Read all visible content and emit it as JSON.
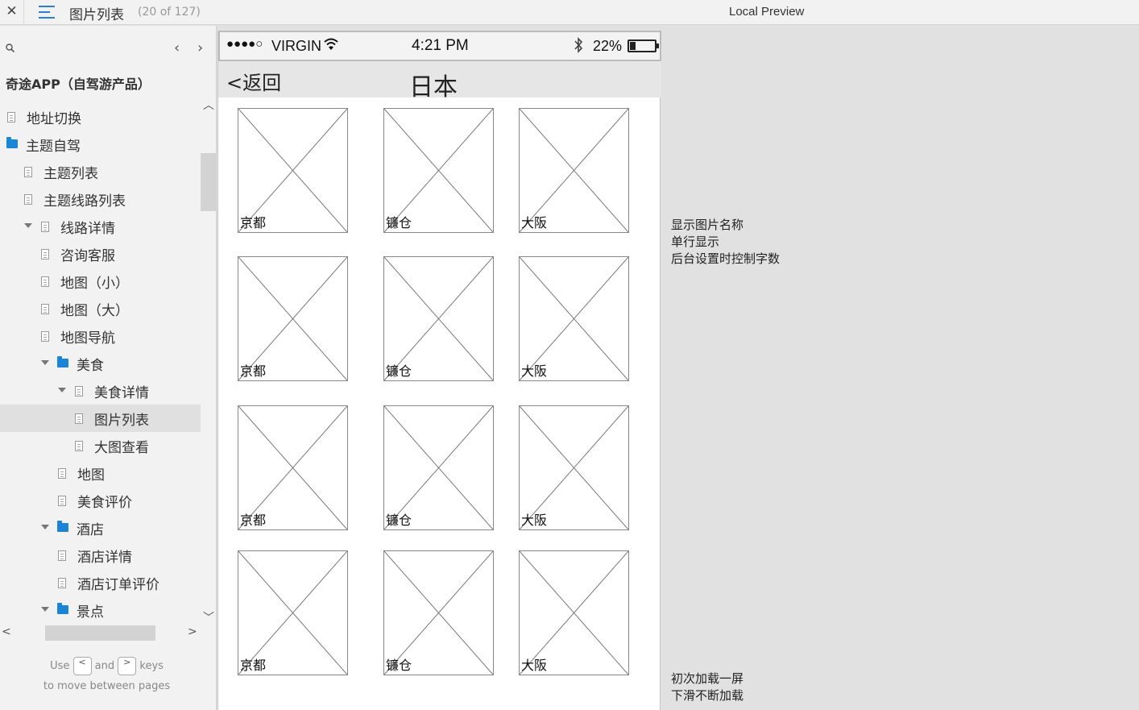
{
  "topbar": {
    "close_glyph": "✕",
    "page_title": "图片列表",
    "page_count": "(20 of 127)",
    "preview_title": "Local Preview"
  },
  "sidebar": {
    "search_icon": "search-icon",
    "prev_glyph": "‹",
    "next_glyph": "›",
    "project_title": "奇途APP（自驾游产品）",
    "items": [
      {
        "label": "地址切换",
        "type": "page",
        "level": 0,
        "expanded": false
      },
      {
        "label": "主题自驾",
        "type": "folder",
        "level": 0,
        "expanded": false
      },
      {
        "label": "主题列表",
        "type": "page",
        "level": 1,
        "expanded": false
      },
      {
        "label": "主题线路列表",
        "type": "page",
        "level": 1,
        "expanded": false
      },
      {
        "label": "线路详情",
        "type": "page",
        "level": 1,
        "expanded": true
      },
      {
        "label": "咨询客服",
        "type": "page",
        "level": 2,
        "expanded": false
      },
      {
        "label": "地图（小）",
        "type": "page",
        "level": 2,
        "expanded": false
      },
      {
        "label": "地图（大）",
        "type": "page",
        "level": 2,
        "expanded": false
      },
      {
        "label": "地图导航",
        "type": "page",
        "level": 2,
        "expanded": false
      },
      {
        "label": "美食",
        "type": "folder",
        "level": 2,
        "expanded": true
      },
      {
        "label": "美食详情",
        "type": "page",
        "level": 3,
        "expanded": true
      },
      {
        "label": "图片列表",
        "type": "page",
        "level": 4,
        "expanded": false,
        "selected": true
      },
      {
        "label": "大图查看",
        "type": "page",
        "level": 4,
        "expanded": false
      },
      {
        "label": "地图",
        "type": "page",
        "level": 3,
        "expanded": false
      },
      {
        "label": "美食评价",
        "type": "page",
        "level": 3,
        "expanded": false
      },
      {
        "label": "酒店",
        "type": "folder",
        "level": 2,
        "expanded": true
      },
      {
        "label": "酒店详情",
        "type": "page",
        "level": 3,
        "expanded": false
      },
      {
        "label": "酒店订单评价",
        "type": "page",
        "level": 3,
        "expanded": false
      },
      {
        "label": "景点",
        "type": "folder",
        "level": 2,
        "expanded": true
      }
    ],
    "help": {
      "use": "Use",
      "key_prev": "<",
      "and": "and",
      "key_next": ">",
      "keys": "keys",
      "line2": "to move between pages"
    }
  },
  "phone": {
    "status": {
      "signal": "●●●●○",
      "carrier": "VIRGIN",
      "time": "4:21 PM",
      "battery": "22%"
    },
    "nav": {
      "back": "<返回",
      "title": "日本"
    },
    "tiles": [
      [
        "京都",
        "镰仓",
        "大阪"
      ],
      [
        "京都",
        "镰仓",
        "大阪"
      ],
      [
        "京都",
        "镰仓",
        "大阪"
      ],
      [
        "京都",
        "镰仓",
        "大阪"
      ]
    ]
  },
  "annotations": {
    "note1": [
      "显示图片名称",
      "单行显示",
      "后台设置时控制字数"
    ],
    "note2": [
      "初次加载一屏",
      "下滑不断加载"
    ]
  },
  "colors": {
    "accent": "#1a85d6",
    "sidebar_bg": "#f2f2f2",
    "canvas_bg": "#e1e1e1",
    "selected_row": "#e0e0e0"
  }
}
